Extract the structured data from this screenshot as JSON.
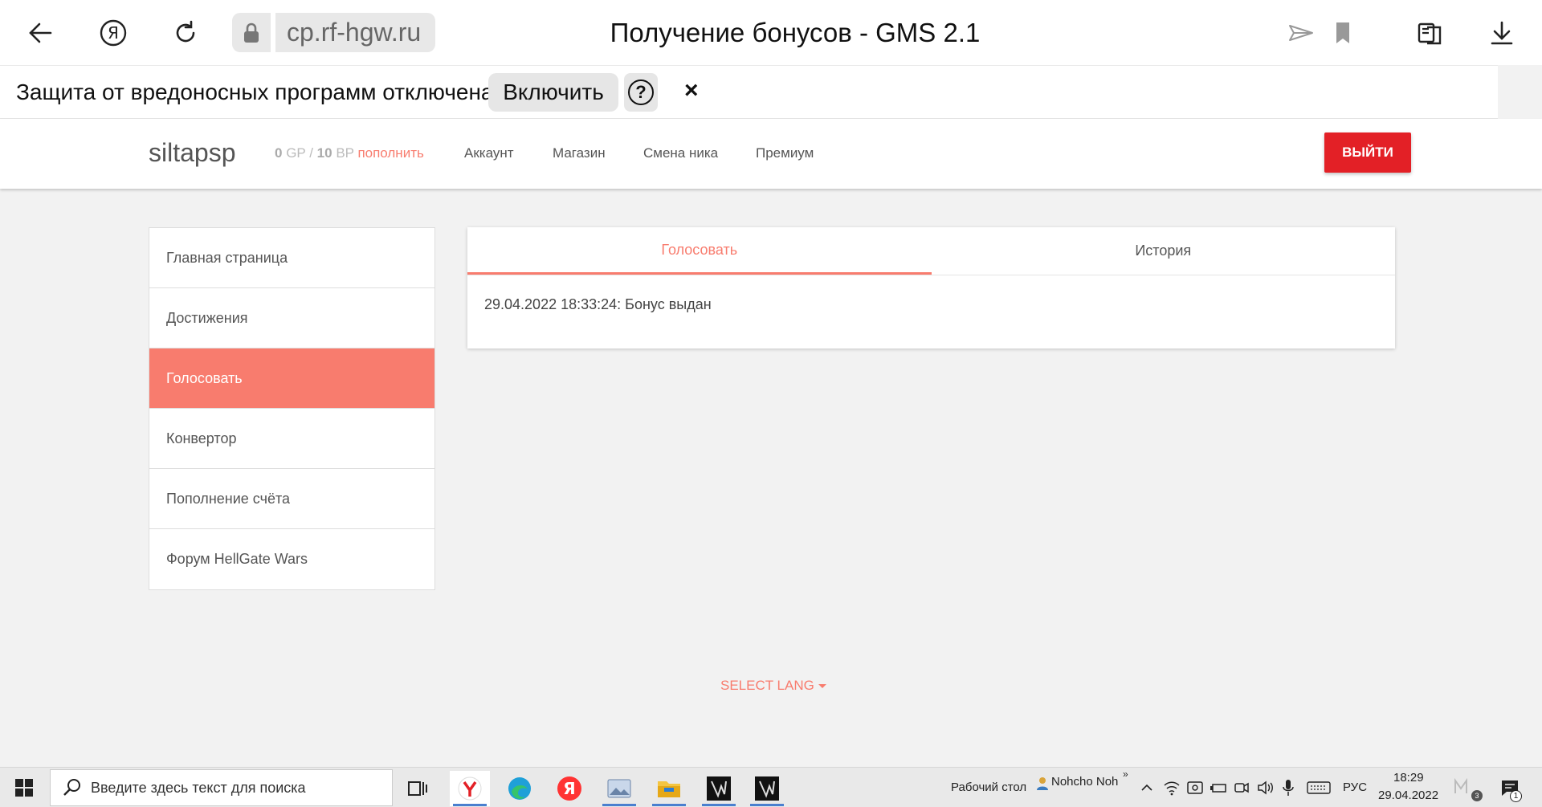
{
  "browser": {
    "url": "cp.rf-hgw.ru",
    "page_title": "Получение бонусов - GMS 2.1"
  },
  "warning": {
    "text": "Защита от вредоносных программ отключена",
    "enable_label": "Включить",
    "help_label": "?",
    "close_label": "×"
  },
  "nav": {
    "username": "siltapsp",
    "gp_value": "0",
    "gp_unit": "GP",
    "separator": "/",
    "bp_value": "10",
    "bp_unit": "BP",
    "topup_label": "пополнить",
    "links": [
      "Аккаунт",
      "Магазин",
      "Смена ника",
      "Премиум"
    ],
    "logout_label": "ВЫЙТИ"
  },
  "sidebar": {
    "items": [
      "Главная страница",
      "Достижения",
      "Голосовать",
      "Конвертор",
      "Пополнение счёта",
      "Форум HellGate Wars"
    ],
    "active_index": 2
  },
  "tabs": {
    "vote": "Голосовать",
    "history": "История"
  },
  "content": {
    "message": "29.04.2022 18:33:24: Бонус выдан"
  },
  "footer": {
    "select_lang": "SELECT LANG"
  },
  "taskbar": {
    "search_placeholder": "Введите здесь текст для поиска",
    "desktop_label": "Рабочий стол",
    "user_label": "Nohcho Noh",
    "chevron": "»",
    "lang": "РУС",
    "time": "18:29",
    "date": "29.04.2022",
    "notification_count": "3",
    "action_badge": "1"
  },
  "colors": {
    "accent": "#f87c6e",
    "logout": "#e32026"
  }
}
